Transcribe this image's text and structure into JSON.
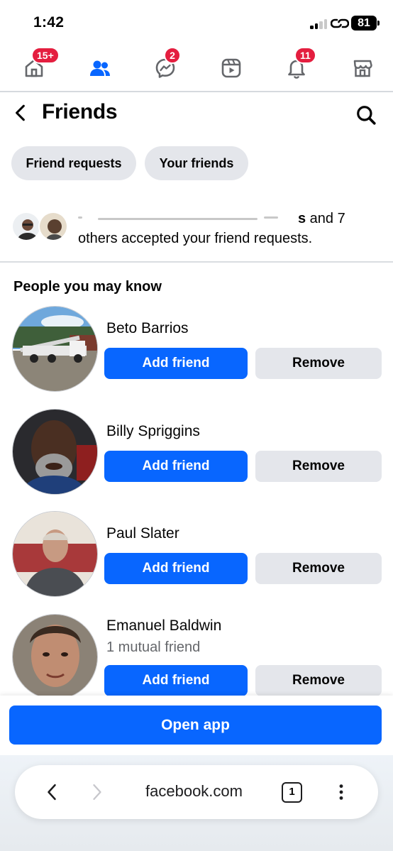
{
  "status_bar": {
    "time": "1:42",
    "battery": "81"
  },
  "nav": {
    "items": [
      {
        "icon": "home-icon",
        "badge": "15+"
      },
      {
        "icon": "friends-icon",
        "badge": "",
        "active": true
      },
      {
        "icon": "messenger-icon",
        "badge": "2"
      },
      {
        "icon": "video-icon",
        "badge": ""
      },
      {
        "icon": "bell-icon",
        "badge": "11"
      },
      {
        "icon": "marketplace-icon",
        "badge": ""
      }
    ],
    "active_color": "#0866ff",
    "badge_color": "#e41e3f"
  },
  "header": {
    "title": "Friends"
  },
  "chips": {
    "friend_requests": "Friend requests",
    "your_friends": "Your friends"
  },
  "notice": {
    "line1_bold_end": "s",
    "line1_tail": " and 7",
    "line2": "others accepted your friend requests."
  },
  "people": {
    "section_title": "People you may know",
    "add_label": "Add friend",
    "remove_label": "Remove",
    "list": [
      {
        "name": "Beto Barrios",
        "mutual": ""
      },
      {
        "name": "Billy Spriggins",
        "mutual": ""
      },
      {
        "name": "Paul Slater",
        "mutual": ""
      },
      {
        "name": "Emanuel Baldwin",
        "mutual": "1 mutual friend"
      }
    ]
  },
  "open_app": {
    "label": "Open app"
  },
  "browser": {
    "url": "facebook.com",
    "tab_count": "1"
  }
}
